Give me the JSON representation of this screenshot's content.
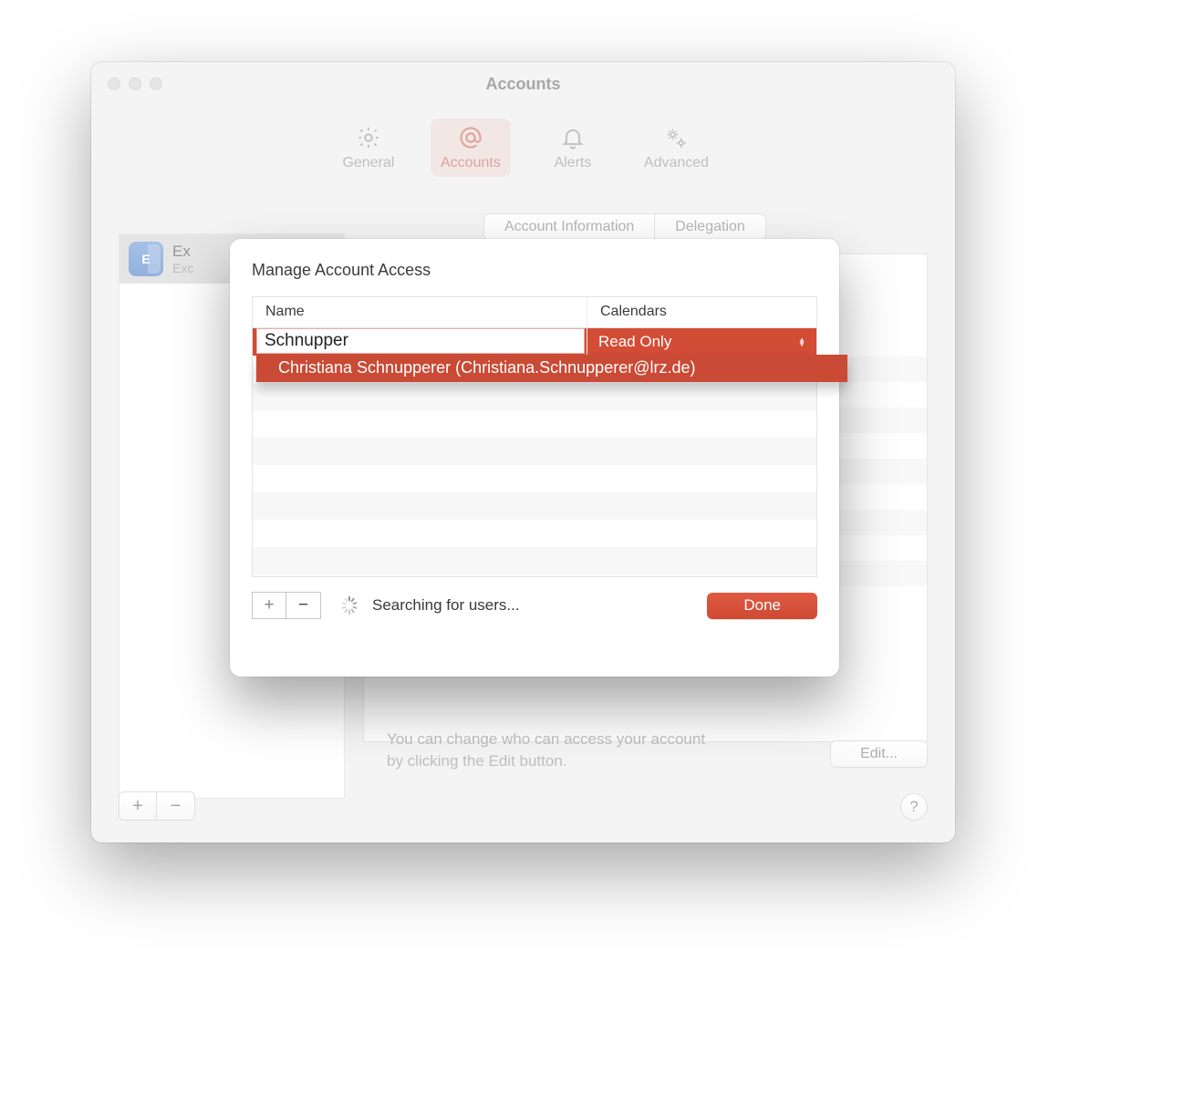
{
  "window": {
    "title": "Accounts"
  },
  "toolbar": {
    "items": [
      {
        "label": "General"
      },
      {
        "label": "Accounts"
      },
      {
        "label": "Alerts"
      },
      {
        "label": "Advanced"
      }
    ]
  },
  "sidebar": {
    "account": {
      "name_visible": "Ex",
      "sub_visible": "Exc",
      "icon_label": "E"
    }
  },
  "tabs": {
    "account_info": "Account Information",
    "delegation": "Delegation"
  },
  "back": {
    "help_text": "You can change who can access your account by clicking the Edit button.",
    "edit_label": "Edit..."
  },
  "footer": {
    "plus_label": "+",
    "minus_label": "−",
    "help_label": "?"
  },
  "sheet": {
    "title": "Manage Account Access",
    "columns": {
      "name": "Name",
      "calendars": "Calendars"
    },
    "input_value": "Schnupper",
    "calendar_permission": "Read Only",
    "autocomplete_result": "Christiana Schnupperer (Christiana.Schnupperer@lrz.de)",
    "status": "Searching for users...",
    "done_label": "Done",
    "plus_label": "+",
    "minus_label": "−"
  }
}
